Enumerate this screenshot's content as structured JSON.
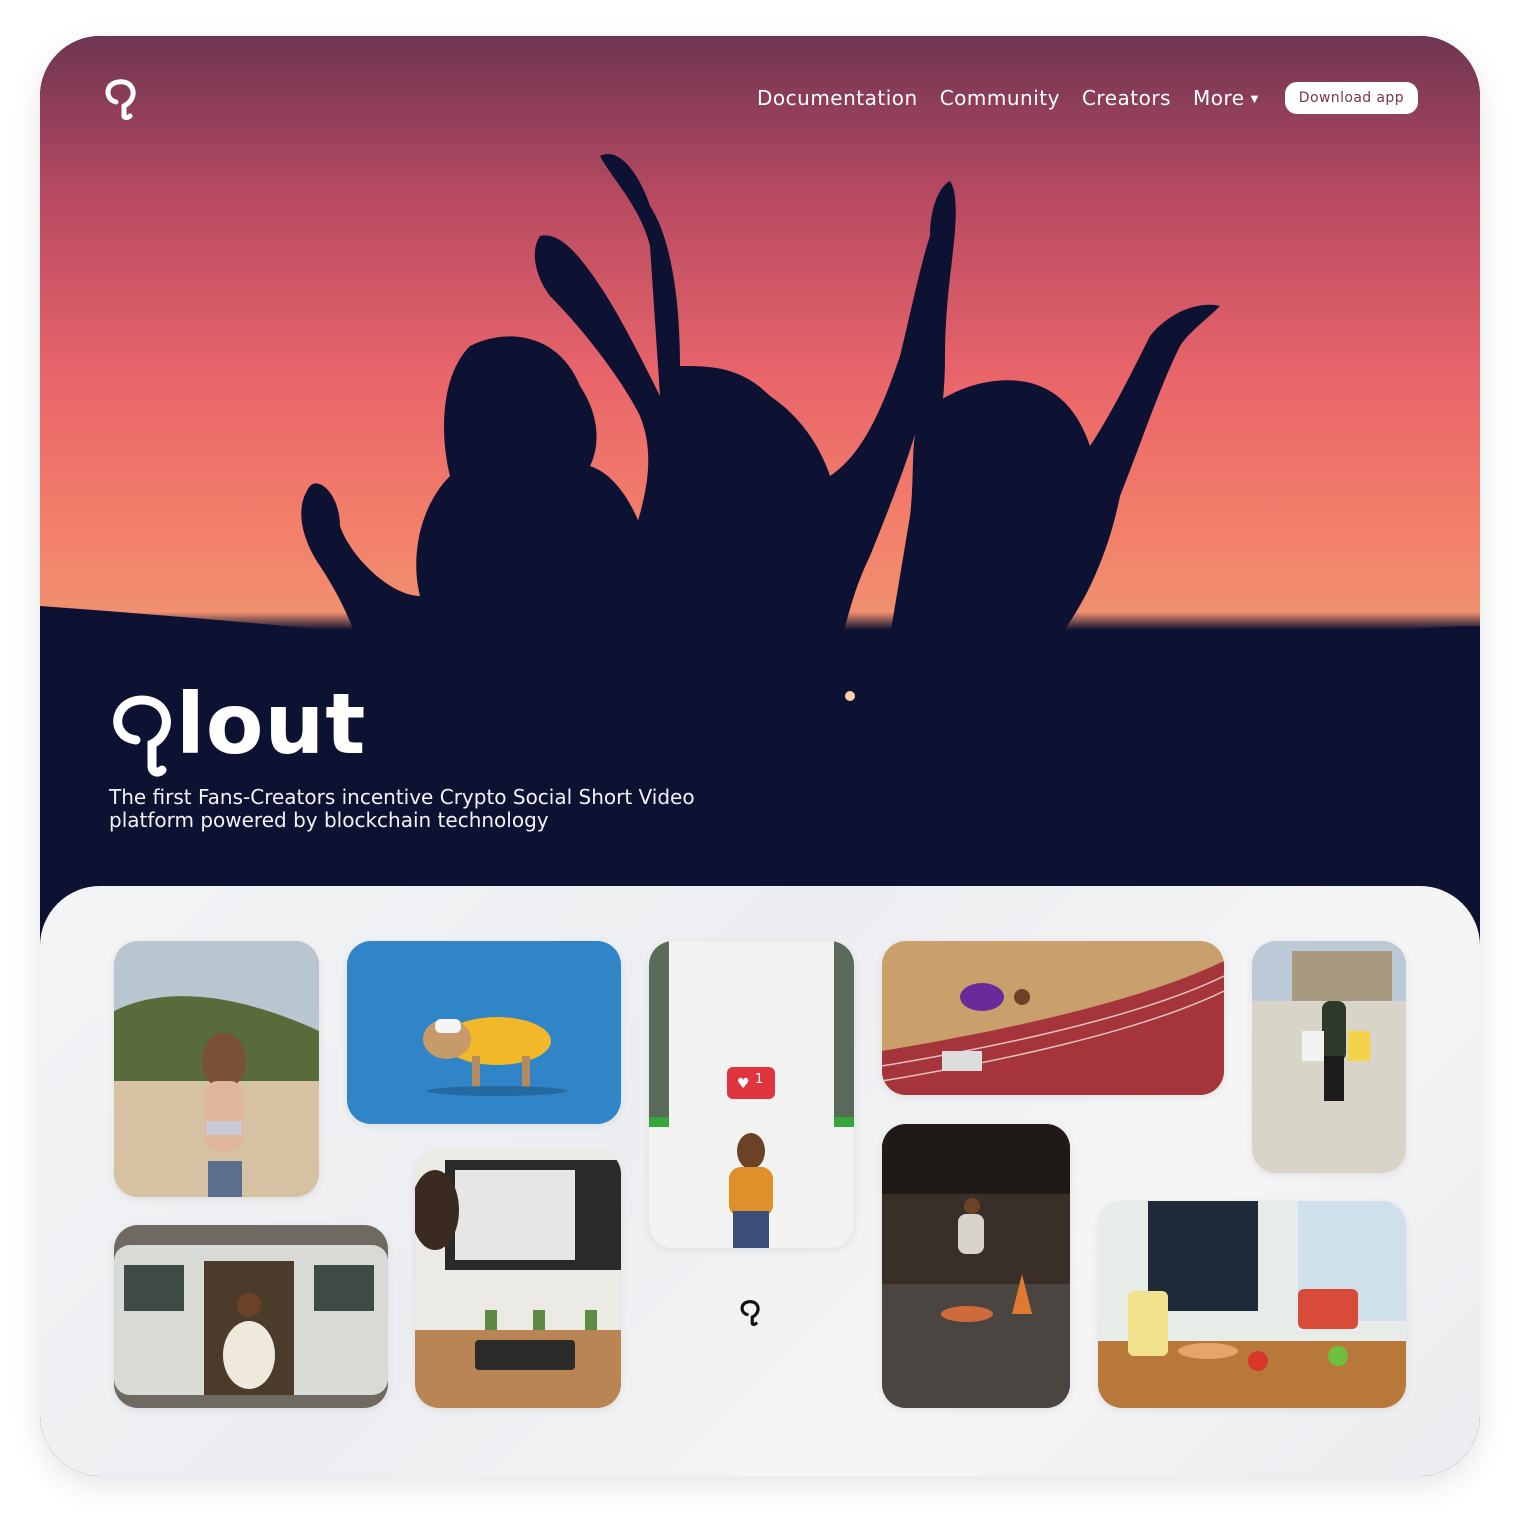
{
  "nav": {
    "items": [
      {
        "label": "Documentation"
      },
      {
        "label": "Community"
      },
      {
        "label": "Creators"
      },
      {
        "label": "More"
      }
    ],
    "download_label": "Download app"
  },
  "hero": {
    "brand_text": "lout",
    "tagline_line1": "The first Fans-Creators incentive Crypto Social Short Video",
    "tagline_line2": "platform powered by blockchain technology"
  },
  "gallery": {
    "like_badge": "1"
  },
  "colors": {
    "navy": "#0d1233",
    "sunset_top": "#6f3552",
    "sunset_mid": "#e9656a",
    "button_text": "#7a3550"
  },
  "icons": [
    "qlout-logo-icon",
    "caret-down-icon",
    "heart-icon"
  ]
}
